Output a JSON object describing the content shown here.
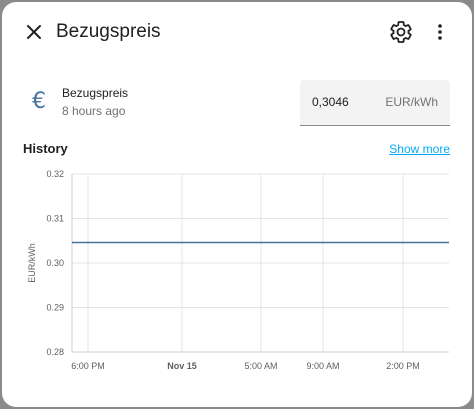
{
  "dialog": {
    "title": "Bezugspreis"
  },
  "entity": {
    "name": "Bezugspreis",
    "last_changed": "8 hours ago",
    "value": "0,3046",
    "unit": "EUR/kWh",
    "icon": "euro-icon",
    "icon_glyph": "€",
    "icon_color": "#44739e"
  },
  "history": {
    "title": "History",
    "show_more": "Show more"
  },
  "chart_data": {
    "type": "line",
    "ylabel": "EUR/kWh",
    "ylim": [
      0.28,
      0.32
    ],
    "y_ticks": [
      "0.32",
      "0.31",
      "0.30",
      "0.29",
      "0.28"
    ],
    "x_ticks": [
      {
        "label": "6:00 PM",
        "bold": false
      },
      {
        "label": "Nov 15",
        "bold": true
      },
      {
        "label": "5:00 AM",
        "bold": false
      },
      {
        "label": "9:00 AM",
        "bold": false
      },
      {
        "label": "2:00 PM",
        "bold": false
      }
    ],
    "series": [
      {
        "color": "#44739e",
        "values": [
          0.3046,
          0.3046
        ]
      }
    ]
  }
}
